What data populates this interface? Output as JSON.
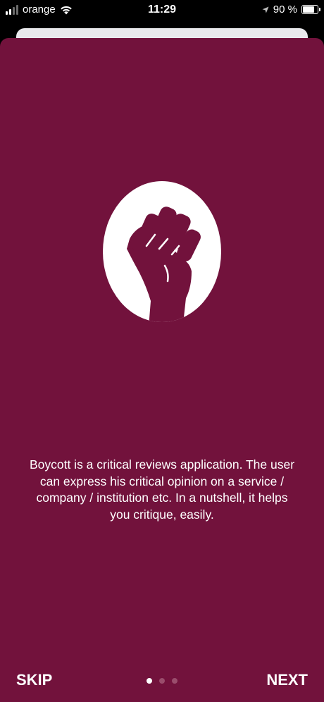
{
  "status_bar": {
    "carrier": "orange",
    "time": "11:29",
    "battery_text": "90 %",
    "battery_level": 0.9
  },
  "onboarding": {
    "description": "Boycott is a critical reviews application. The user can express his critical opinion on a service / company / institution etc. In a nutshell, it helps you critique, easily.",
    "skip_label": "SKIP",
    "next_label": "NEXT",
    "page_count": 3,
    "current_page": 1,
    "logo_icon": "raised-fist-icon"
  },
  "colors": {
    "background": "#72123c",
    "logo_circle": "#ffffff",
    "text": "#ffffff",
    "dot_inactive": "#9a4d6c",
    "dot_active": "#ffffff"
  }
}
